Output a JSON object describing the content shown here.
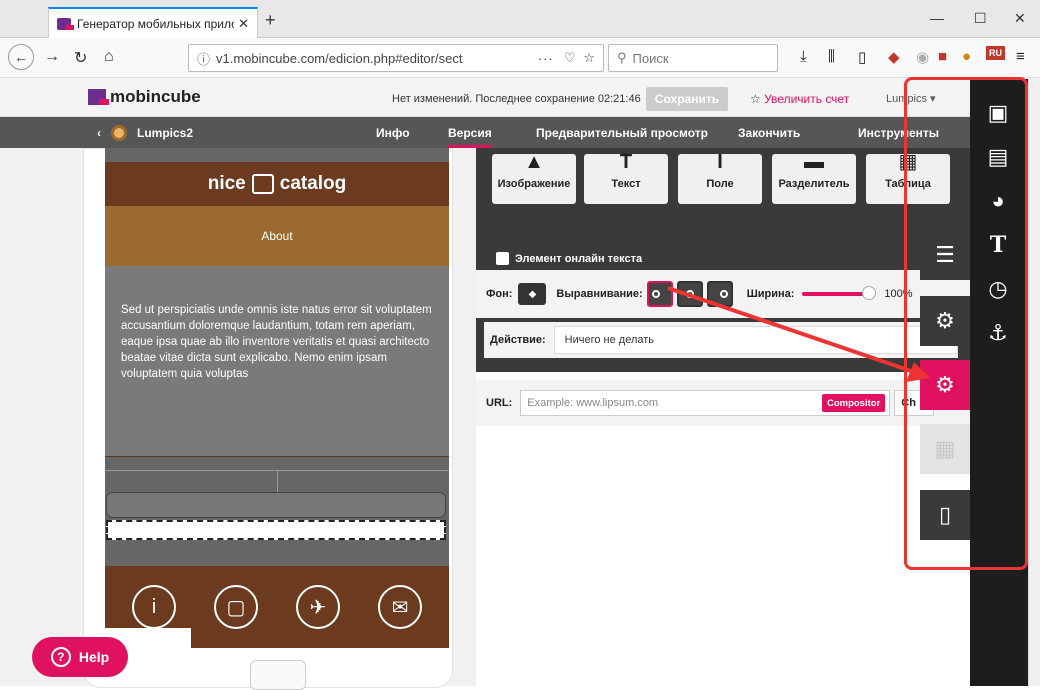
{
  "browser": {
    "tab_title": "Генератор мобильных прило",
    "tab_close": "✕",
    "new_tab": "+",
    "url": "v1.mobincube.com/edicion.php#editor/sect",
    "url_more": "···",
    "search_placeholder": "Поиск",
    "win_minimize": "—",
    "win_maximize": "☐",
    "win_close": "✕",
    "ext_badge_ru": "RU"
  },
  "app": {
    "logo": "mobincube",
    "save_status": "Нет изменений. Последнее сохранение 02:21:46",
    "save_button": "Сохранить",
    "upgrade_link": "Увеличить счет",
    "user_menu": "Lumpics ▾"
  },
  "menu": {
    "project": "Lumpics2",
    "items": [
      "Инфо",
      "Версия",
      "Предварительный просмотр",
      "Закончить",
      "Инструменты"
    ],
    "active": "Версия"
  },
  "preview": {
    "header_left": "nice",
    "header_right": "catalog",
    "about": "About",
    "body_text": "Sed ut perspiciatis unde omnis iste natus error sit voluptatem accusantium doloremque laudantium, totam rem aperiam, eaque ipsa quae ab illo inventore veritatis et quasi architecto beatae vitae dicta sunt explicabo. Nemo enim ipsam voluptatem quia voluptas",
    "footer_icons": [
      "info-icon",
      "tablet-icon",
      "twitter-icon",
      "mail-icon"
    ]
  },
  "help_button": "Help",
  "elements": [
    {
      "label": "Изображение",
      "icon": "image-icon"
    },
    {
      "label": "Текст",
      "icon": "text-icon"
    },
    {
      "label": "Поле",
      "icon": "field-icon"
    },
    {
      "label": "Разделитель",
      "icon": "divider-icon"
    },
    {
      "label": "Таблица",
      "icon": "table-icon"
    }
  ],
  "section_title": "Элемент онлайн текста",
  "props": {
    "bg_label": "Фон:",
    "align_label": "Выравнивание:",
    "width_label": "Ширина:",
    "width_value": "100%"
  },
  "action": {
    "label": "Действие:",
    "value": "Ничего не делать"
  },
  "url_field": {
    "label": "URL:",
    "placeholder": "Example: www.lipsum.com",
    "compositor": "Compositor",
    "ch": "Ch"
  },
  "accent": "#e0115f"
}
